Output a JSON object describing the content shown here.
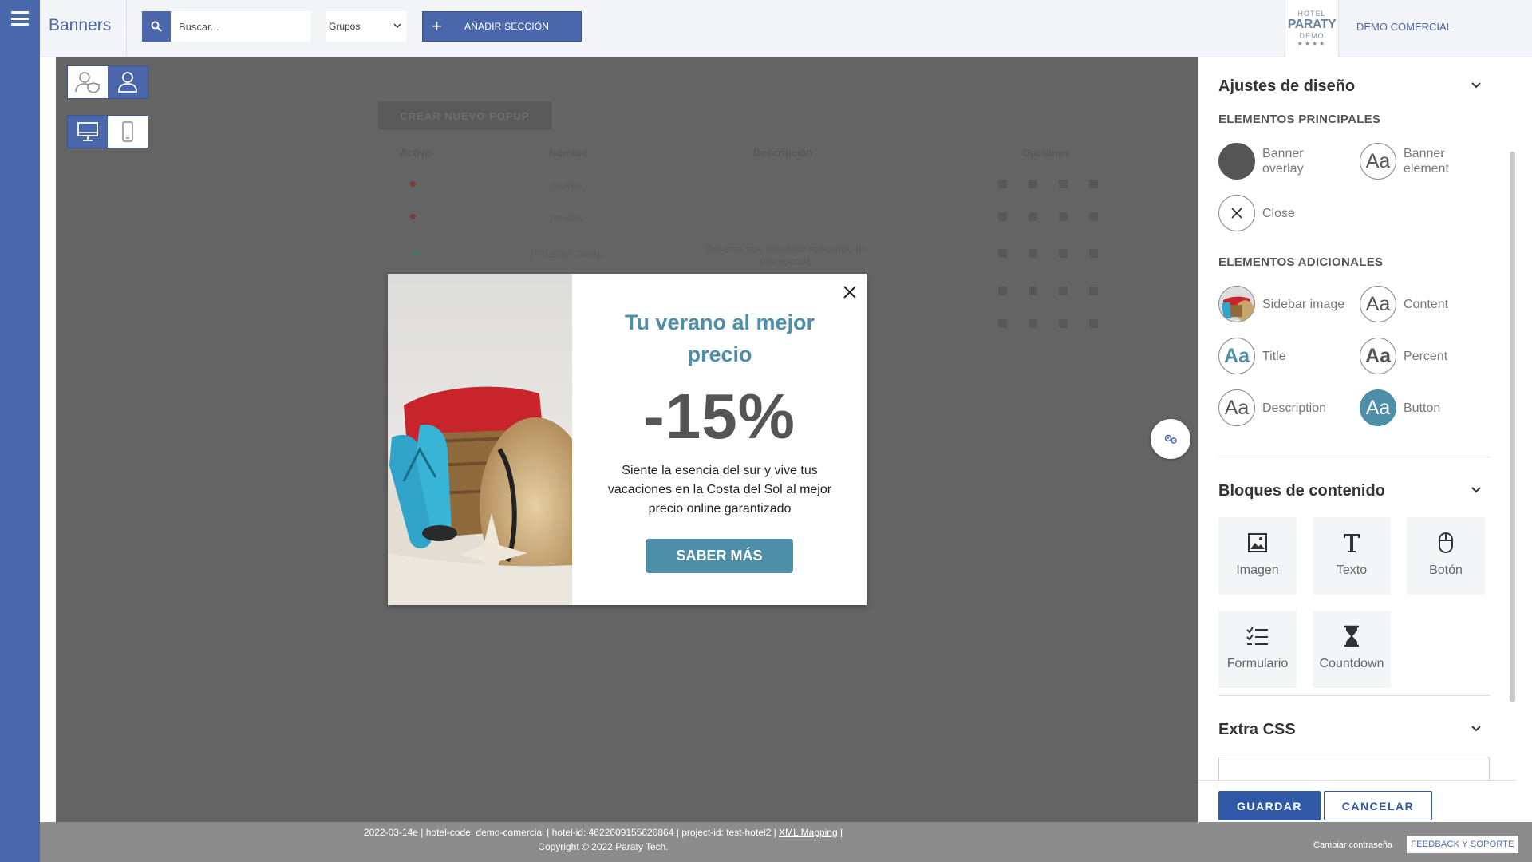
{
  "topbar": {
    "app_title": "Banners",
    "search_placeholder": "Buscar...",
    "groups_select": "Grupos",
    "add_section_label": "AÑADIR SECCIÓN",
    "hotel_logo": {
      "line1": "HOTEL",
      "line2": "PARATY",
      "line3": "DEMO",
      "line4": "★★★★"
    },
    "account_label": "DEMO COMERCIAL"
  },
  "background_list": {
    "create_button": "CREAR NUEVO POPUP",
    "headers": [
      "Activo",
      "Nombre",
      "Descripción",
      "Opciones"
    ],
    "rows": [
      {
        "name": "prueba",
        "description": "",
        "active": false
      },
      {
        "name": "prueba",
        "description": "",
        "active": false
      },
      {
        "name": "PRUEBA Josep",
        "description": "Reserva con nosotros aplicando un promocode",
        "active": true
      },
      {
        "name": "",
        "description": "",
        "active": false
      },
      {
        "name": "",
        "description": "",
        "active": false
      }
    ]
  },
  "popup": {
    "title": "Tu verano al mejor precio",
    "percent": "-15%",
    "description": "Siente la esencia del sur y vive tus vacaciones en la Costa del Sol al mejor precio online garantizado",
    "button_label": "SABER MÁS",
    "accent_color": "#4d8ea8"
  },
  "panel": {
    "design_settings_title": "Ajustes de diseño",
    "main_elements_title": "ELEMENTOS PRINCIPALES",
    "main_elements": [
      {
        "label": "Banner overlay",
        "icon": "filled-circle"
      },
      {
        "label": "Banner element",
        "icon": "Aa"
      },
      {
        "label": "Close",
        "icon": "close-x"
      }
    ],
    "additional_elements_title": "ELEMENTOS ADICIONALES",
    "additional_elements": [
      {
        "label": "Sidebar image",
        "icon": "image-thumb"
      },
      {
        "label": "Content",
        "icon": "Aa"
      },
      {
        "label": "Title",
        "icon": "Aa"
      },
      {
        "label": "Percent",
        "icon": "Aa"
      },
      {
        "label": "Description",
        "icon": "Aa"
      },
      {
        "label": "Button",
        "icon": "Aa"
      }
    ],
    "content_blocks_title": "Bloques de contenido",
    "content_blocks": [
      {
        "label": "Imagen",
        "icon": "image-icon"
      },
      {
        "label": "Texto",
        "icon": "text-icon"
      },
      {
        "label": "Botón",
        "icon": "mouse-icon"
      },
      {
        "label": "Formulario",
        "icon": "checklist-icon"
      },
      {
        "label": "Countdown",
        "icon": "hourglass-icon"
      }
    ],
    "extra_css_title": "Extra CSS",
    "save_label": "GUARDAR",
    "cancel_label": "CANCELAR"
  },
  "footer": {
    "info_prefix": "2022-03-14e | hotel-code: demo-comercial | hotel-id: 4622609155620864 | project-id: test-hotel2 | ",
    "xml_link": "XML Mapping",
    "info_suffix": " |",
    "copyright": "Copyright © 2022 Paraty Tech.",
    "change_password": "Cambiar contraseña",
    "feedback_label": "FEEDBACK Y SOPORTE"
  }
}
